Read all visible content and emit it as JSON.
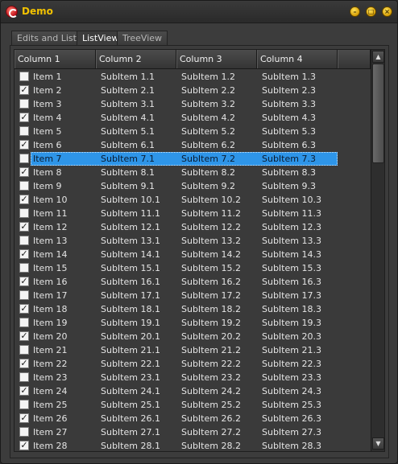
{
  "window": {
    "title": "Demo",
    "minimize_label": "–",
    "maximize_label": "□",
    "close_label": "×"
  },
  "tabs": [
    {
      "label": "Edits and Lists"
    },
    {
      "label": "ListView"
    },
    {
      "label": "TreeView"
    }
  ],
  "listview": {
    "columns": [
      "Column 1",
      "Column 2",
      "Column 3",
      "Column 4"
    ],
    "selected_row": 7,
    "rows": [
      {
        "c1": "Item 1",
        "c2": "SubItem 1.1",
        "c3": "SubItem 1.2",
        "c4": "SubItem 1.3",
        "checked": false
      },
      {
        "c1": "Item 2",
        "c2": "SubItem 2.1",
        "c3": "SubItem 2.2",
        "c4": "SubItem 2.3",
        "checked": true
      },
      {
        "c1": "Item 3",
        "c2": "SubItem 3.1",
        "c3": "SubItem 3.2",
        "c4": "SubItem 3.3",
        "checked": false
      },
      {
        "c1": "Item 4",
        "c2": "SubItem 4.1",
        "c3": "SubItem 4.2",
        "c4": "SubItem 4.3",
        "checked": true
      },
      {
        "c1": "Item 5",
        "c2": "SubItem 5.1",
        "c3": "SubItem 5.2",
        "c4": "SubItem 5.3",
        "checked": false
      },
      {
        "c1": "Item 6",
        "c2": "SubItem 6.1",
        "c3": "SubItem 6.2",
        "c4": "SubItem 6.3",
        "checked": true
      },
      {
        "c1": "Item 7",
        "c2": "SubItem 7.1",
        "c3": "SubItem 7.2",
        "c4": "SubItem 7.3",
        "checked": false
      },
      {
        "c1": "Item 8",
        "c2": "SubItem 8.1",
        "c3": "SubItem 8.2",
        "c4": "SubItem 8.3",
        "checked": true
      },
      {
        "c1": "Item 9",
        "c2": "SubItem 9.1",
        "c3": "SubItem 9.2",
        "c4": "SubItem 9.3",
        "checked": false
      },
      {
        "c1": "Item 10",
        "c2": "SubItem 10.1",
        "c3": "SubItem 10.2",
        "c4": "SubItem 10.3",
        "checked": true
      },
      {
        "c1": "Item 11",
        "c2": "SubItem 11.1",
        "c3": "SubItem 11.2",
        "c4": "SubItem 11.3",
        "checked": false
      },
      {
        "c1": "Item 12",
        "c2": "SubItem 12.1",
        "c3": "SubItem 12.2",
        "c4": "SubItem 12.3",
        "checked": true
      },
      {
        "c1": "Item 13",
        "c2": "SubItem 13.1",
        "c3": "SubItem 13.2",
        "c4": "SubItem 13.3",
        "checked": false
      },
      {
        "c1": "Item 14",
        "c2": "SubItem 14.1",
        "c3": "SubItem 14.2",
        "c4": "SubItem 14.3",
        "checked": true
      },
      {
        "c1": "Item 15",
        "c2": "SubItem 15.1",
        "c3": "SubItem 15.2",
        "c4": "SubItem 15.3",
        "checked": false
      },
      {
        "c1": "Item 16",
        "c2": "SubItem 16.1",
        "c3": "SubItem 16.2",
        "c4": "SubItem 16.3",
        "checked": true
      },
      {
        "c1": "Item 17",
        "c2": "SubItem 17.1",
        "c3": "SubItem 17.2",
        "c4": "SubItem 17.3",
        "checked": false
      },
      {
        "c1": "Item 18",
        "c2": "SubItem 18.1",
        "c3": "SubItem 18.2",
        "c4": "SubItem 18.3",
        "checked": true
      },
      {
        "c1": "Item 19",
        "c2": "SubItem 19.1",
        "c3": "SubItem 19.2",
        "c4": "SubItem 19.3",
        "checked": false
      },
      {
        "c1": "Item 20",
        "c2": "SubItem 20.1",
        "c3": "SubItem 20.2",
        "c4": "SubItem 20.3",
        "checked": true
      },
      {
        "c1": "Item 21",
        "c2": "SubItem 21.1",
        "c3": "SubItem 21.2",
        "c4": "SubItem 21.3",
        "checked": false
      },
      {
        "c1": "Item 22",
        "c2": "SubItem 22.1",
        "c3": "SubItem 22.2",
        "c4": "SubItem 22.3",
        "checked": true
      },
      {
        "c1": "Item 23",
        "c2": "SubItem 23.1",
        "c3": "SubItem 23.2",
        "c4": "SubItem 23.3",
        "checked": false
      },
      {
        "c1": "Item 24",
        "c2": "SubItem 24.1",
        "c3": "SubItem 24.2",
        "c4": "SubItem 24.3",
        "checked": true
      },
      {
        "c1": "Item 25",
        "c2": "SubItem 25.1",
        "c3": "SubItem 25.2",
        "c4": "SubItem 25.3",
        "checked": false
      },
      {
        "c1": "Item 26",
        "c2": "SubItem 26.1",
        "c3": "SubItem 26.2",
        "c4": "SubItem 26.3",
        "checked": true
      },
      {
        "c1": "Item 27",
        "c2": "SubItem 27.1",
        "c3": "SubItem 27.2",
        "c4": "SubItem 27.3",
        "checked": false
      },
      {
        "c1": "Item 28",
        "c2": "SubItem 28.1",
        "c3": "SubItem 28.2",
        "c4": "SubItem 28.3",
        "checked": true
      }
    ]
  },
  "scrollbar": {
    "up_icon": "▲",
    "down_icon": "▼"
  },
  "colors": {
    "title": "#f2c200",
    "selection": "#2e95e8",
    "background": "#3c3c3c"
  }
}
